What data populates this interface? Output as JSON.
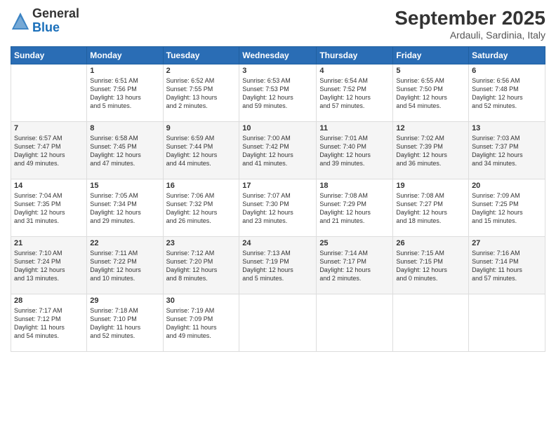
{
  "logo": {
    "general": "General",
    "blue": "Blue"
  },
  "header": {
    "month": "September 2025",
    "location": "Ardauli, Sardinia, Italy"
  },
  "days": [
    "Sunday",
    "Monday",
    "Tuesday",
    "Wednesday",
    "Thursday",
    "Friday",
    "Saturday"
  ],
  "weeks": [
    [
      {
        "date": "",
        "info": ""
      },
      {
        "date": "1",
        "info": "Sunrise: 6:51 AM\nSunset: 7:56 PM\nDaylight: 13 hours\nand 5 minutes."
      },
      {
        "date": "2",
        "info": "Sunrise: 6:52 AM\nSunset: 7:55 PM\nDaylight: 13 hours\nand 2 minutes."
      },
      {
        "date": "3",
        "info": "Sunrise: 6:53 AM\nSunset: 7:53 PM\nDaylight: 12 hours\nand 59 minutes."
      },
      {
        "date": "4",
        "info": "Sunrise: 6:54 AM\nSunset: 7:52 PM\nDaylight: 12 hours\nand 57 minutes."
      },
      {
        "date": "5",
        "info": "Sunrise: 6:55 AM\nSunset: 7:50 PM\nDaylight: 12 hours\nand 54 minutes."
      },
      {
        "date": "6",
        "info": "Sunrise: 6:56 AM\nSunset: 7:48 PM\nDaylight: 12 hours\nand 52 minutes."
      }
    ],
    [
      {
        "date": "7",
        "info": "Sunrise: 6:57 AM\nSunset: 7:47 PM\nDaylight: 12 hours\nand 49 minutes."
      },
      {
        "date": "8",
        "info": "Sunrise: 6:58 AM\nSunset: 7:45 PM\nDaylight: 12 hours\nand 47 minutes."
      },
      {
        "date": "9",
        "info": "Sunrise: 6:59 AM\nSunset: 7:44 PM\nDaylight: 12 hours\nand 44 minutes."
      },
      {
        "date": "10",
        "info": "Sunrise: 7:00 AM\nSunset: 7:42 PM\nDaylight: 12 hours\nand 41 minutes."
      },
      {
        "date": "11",
        "info": "Sunrise: 7:01 AM\nSunset: 7:40 PM\nDaylight: 12 hours\nand 39 minutes."
      },
      {
        "date": "12",
        "info": "Sunrise: 7:02 AM\nSunset: 7:39 PM\nDaylight: 12 hours\nand 36 minutes."
      },
      {
        "date": "13",
        "info": "Sunrise: 7:03 AM\nSunset: 7:37 PM\nDaylight: 12 hours\nand 34 minutes."
      }
    ],
    [
      {
        "date": "14",
        "info": "Sunrise: 7:04 AM\nSunset: 7:35 PM\nDaylight: 12 hours\nand 31 minutes."
      },
      {
        "date": "15",
        "info": "Sunrise: 7:05 AM\nSunset: 7:34 PM\nDaylight: 12 hours\nand 29 minutes."
      },
      {
        "date": "16",
        "info": "Sunrise: 7:06 AM\nSunset: 7:32 PM\nDaylight: 12 hours\nand 26 minutes."
      },
      {
        "date": "17",
        "info": "Sunrise: 7:07 AM\nSunset: 7:30 PM\nDaylight: 12 hours\nand 23 minutes."
      },
      {
        "date": "18",
        "info": "Sunrise: 7:08 AM\nSunset: 7:29 PM\nDaylight: 12 hours\nand 21 minutes."
      },
      {
        "date": "19",
        "info": "Sunrise: 7:08 AM\nSunset: 7:27 PM\nDaylight: 12 hours\nand 18 minutes."
      },
      {
        "date": "20",
        "info": "Sunrise: 7:09 AM\nSunset: 7:25 PM\nDaylight: 12 hours\nand 15 minutes."
      }
    ],
    [
      {
        "date": "21",
        "info": "Sunrise: 7:10 AM\nSunset: 7:24 PM\nDaylight: 12 hours\nand 13 minutes."
      },
      {
        "date": "22",
        "info": "Sunrise: 7:11 AM\nSunset: 7:22 PM\nDaylight: 12 hours\nand 10 minutes."
      },
      {
        "date": "23",
        "info": "Sunrise: 7:12 AM\nSunset: 7:20 PM\nDaylight: 12 hours\nand 8 minutes."
      },
      {
        "date": "24",
        "info": "Sunrise: 7:13 AM\nSunset: 7:19 PM\nDaylight: 12 hours\nand 5 minutes."
      },
      {
        "date": "25",
        "info": "Sunrise: 7:14 AM\nSunset: 7:17 PM\nDaylight: 12 hours\nand 2 minutes."
      },
      {
        "date": "26",
        "info": "Sunrise: 7:15 AM\nSunset: 7:15 PM\nDaylight: 12 hours\nand 0 minutes."
      },
      {
        "date": "27",
        "info": "Sunrise: 7:16 AM\nSunset: 7:14 PM\nDaylight: 11 hours\nand 57 minutes."
      }
    ],
    [
      {
        "date": "28",
        "info": "Sunrise: 7:17 AM\nSunset: 7:12 PM\nDaylight: 11 hours\nand 54 minutes."
      },
      {
        "date": "29",
        "info": "Sunrise: 7:18 AM\nSunset: 7:10 PM\nDaylight: 11 hours\nand 52 minutes."
      },
      {
        "date": "30",
        "info": "Sunrise: 7:19 AM\nSunset: 7:09 PM\nDaylight: 11 hours\nand 49 minutes."
      },
      {
        "date": "",
        "info": ""
      },
      {
        "date": "",
        "info": ""
      },
      {
        "date": "",
        "info": ""
      },
      {
        "date": "",
        "info": ""
      }
    ]
  ]
}
